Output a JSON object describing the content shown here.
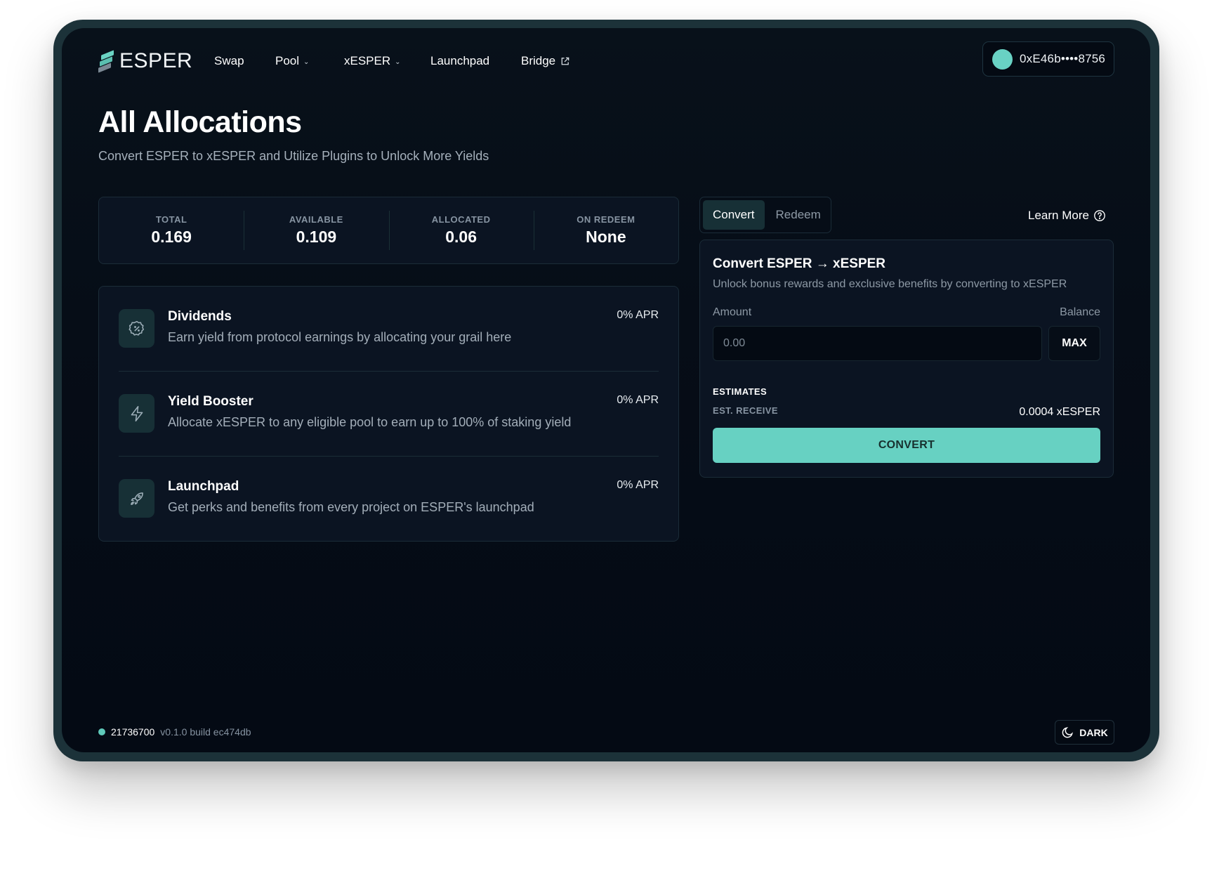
{
  "brand": {
    "name": "ESPER",
    "accent": "#67d1c2"
  },
  "nav": {
    "items": [
      {
        "label": "Swap",
        "icon": null
      },
      {
        "label": "Pool",
        "icon": "chevron-down-icon"
      },
      {
        "label": "xESPER",
        "icon": "chevron-down-icon"
      },
      {
        "label": "Launchpad",
        "icon": null
      },
      {
        "label": "Bridge",
        "icon": "external-link-icon"
      }
    ]
  },
  "wallet": {
    "address": "0xE46b••••8756"
  },
  "header": {
    "title": "All Allocations",
    "subtitle": "Convert ESPER to xESPER and Utilize Plugins to Unlock More Yields"
  },
  "stats": [
    {
      "label": "TOTAL",
      "value": "0.169"
    },
    {
      "label": "AVAILABLE",
      "value": "0.109"
    },
    {
      "label": "ALLOCATED",
      "value": "0.06"
    },
    {
      "label": "ON REDEEM",
      "value": "None"
    }
  ],
  "plugins": [
    {
      "name": "Dividends",
      "description": "Earn yield from protocol earnings by allocating your grail here",
      "apr": "0% APR",
      "icon": "percent-badge-icon"
    },
    {
      "name": "Yield Booster",
      "description": "Allocate xESPER to any eligible pool to earn up to 100% of staking yield",
      "apr": "0% APR",
      "icon": "lightning-icon"
    },
    {
      "name": "Launchpad",
      "description": "Get perks and benefits from every project on ESPER's launchpad",
      "apr": "0% APR",
      "icon": "rocket-icon"
    }
  ],
  "tabs": [
    {
      "label": "Convert",
      "active": true
    },
    {
      "label": "Redeem",
      "active": false
    }
  ],
  "learn_more": {
    "label": "Learn More",
    "icon": "help-circle-icon"
  },
  "convert": {
    "title": "Convert ESPER → xESPER",
    "subtitle": "Unlock bonus rewards and exclusive benefits by converting to xESPER",
    "amount_label": "Amount",
    "balance_label": "Balance",
    "input_value": "",
    "input_placeholder": "0.00",
    "max_label": "MAX",
    "estimates_heading": "ESTIMATES",
    "est_receive_label": "EST. RECEIVE",
    "est_receive_value": "0.0004 xESPER",
    "button_label": "CONVERT"
  },
  "footer": {
    "block": "21736700",
    "version": "v0.1.0 build ec474db",
    "theme_label": "DARK",
    "theme_icon": "moon-icon"
  }
}
